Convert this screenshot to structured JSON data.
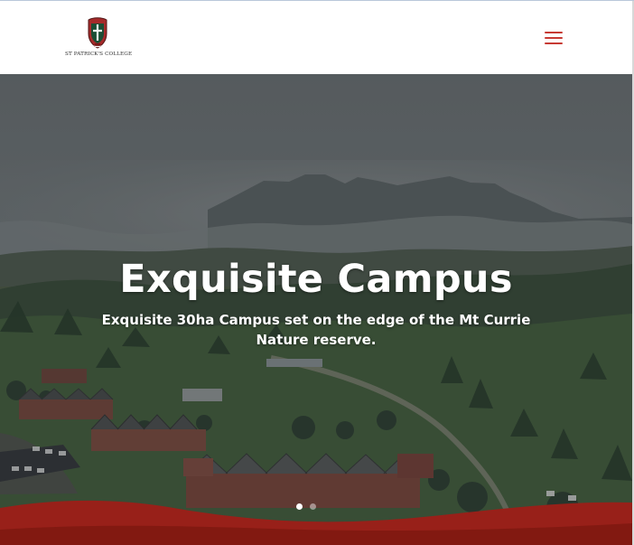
{
  "brand": {
    "name": "ST PATRICK'S COLLEGE",
    "crest_icon": "school-crest-icon"
  },
  "navigation": {
    "menu_icon": "hamburger-menu-icon"
  },
  "hero": {
    "title": "Exquisite Campus",
    "subtitle_line_1": "Exquisite 30ha Campus set on the edge of the Mt Currie",
    "subtitle_line_2": "Nature reserve.",
    "slide_count": 2,
    "active_slide": 1
  },
  "colors": {
    "accent_red": "#c73a33",
    "wave_red": "#982019",
    "overlay": "#2c2f31"
  }
}
